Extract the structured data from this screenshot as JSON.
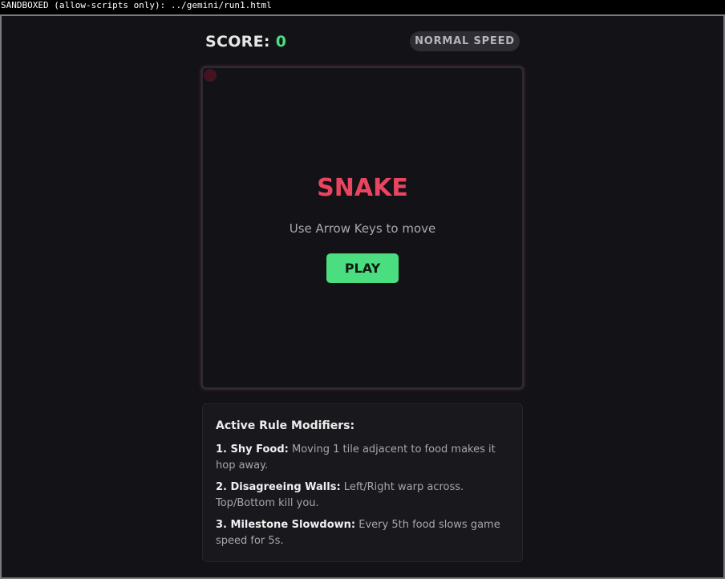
{
  "browser": {
    "sandbox_banner": "SANDBOXED (allow-scripts only): ../gemini/run1.html"
  },
  "hud": {
    "score_label": "SCORE:",
    "score_value": "0",
    "speed_badge": "NORMAL SPEED"
  },
  "game": {
    "title": "SNAKE",
    "instructions": "Use Arrow Keys to move",
    "play_label": "PLAY"
  },
  "rules": {
    "title": "Active Rule Modifiers:",
    "items": [
      {
        "name": "1. Shy Food:",
        "text": " Moving 1 tile adjacent to food makes it hop away."
      },
      {
        "name": "2. Disagreeing Walls:",
        "text": " Left/Right warp across. Top/Bottom kill you."
      },
      {
        "name": "3. Milestone Slowdown:",
        "text": " Every 5th food slows game speed for 5s."
      }
    ]
  },
  "colors": {
    "accent_red": "#e94560",
    "accent_green": "#4ade80",
    "background": "#131217",
    "panel": "#19181d"
  }
}
